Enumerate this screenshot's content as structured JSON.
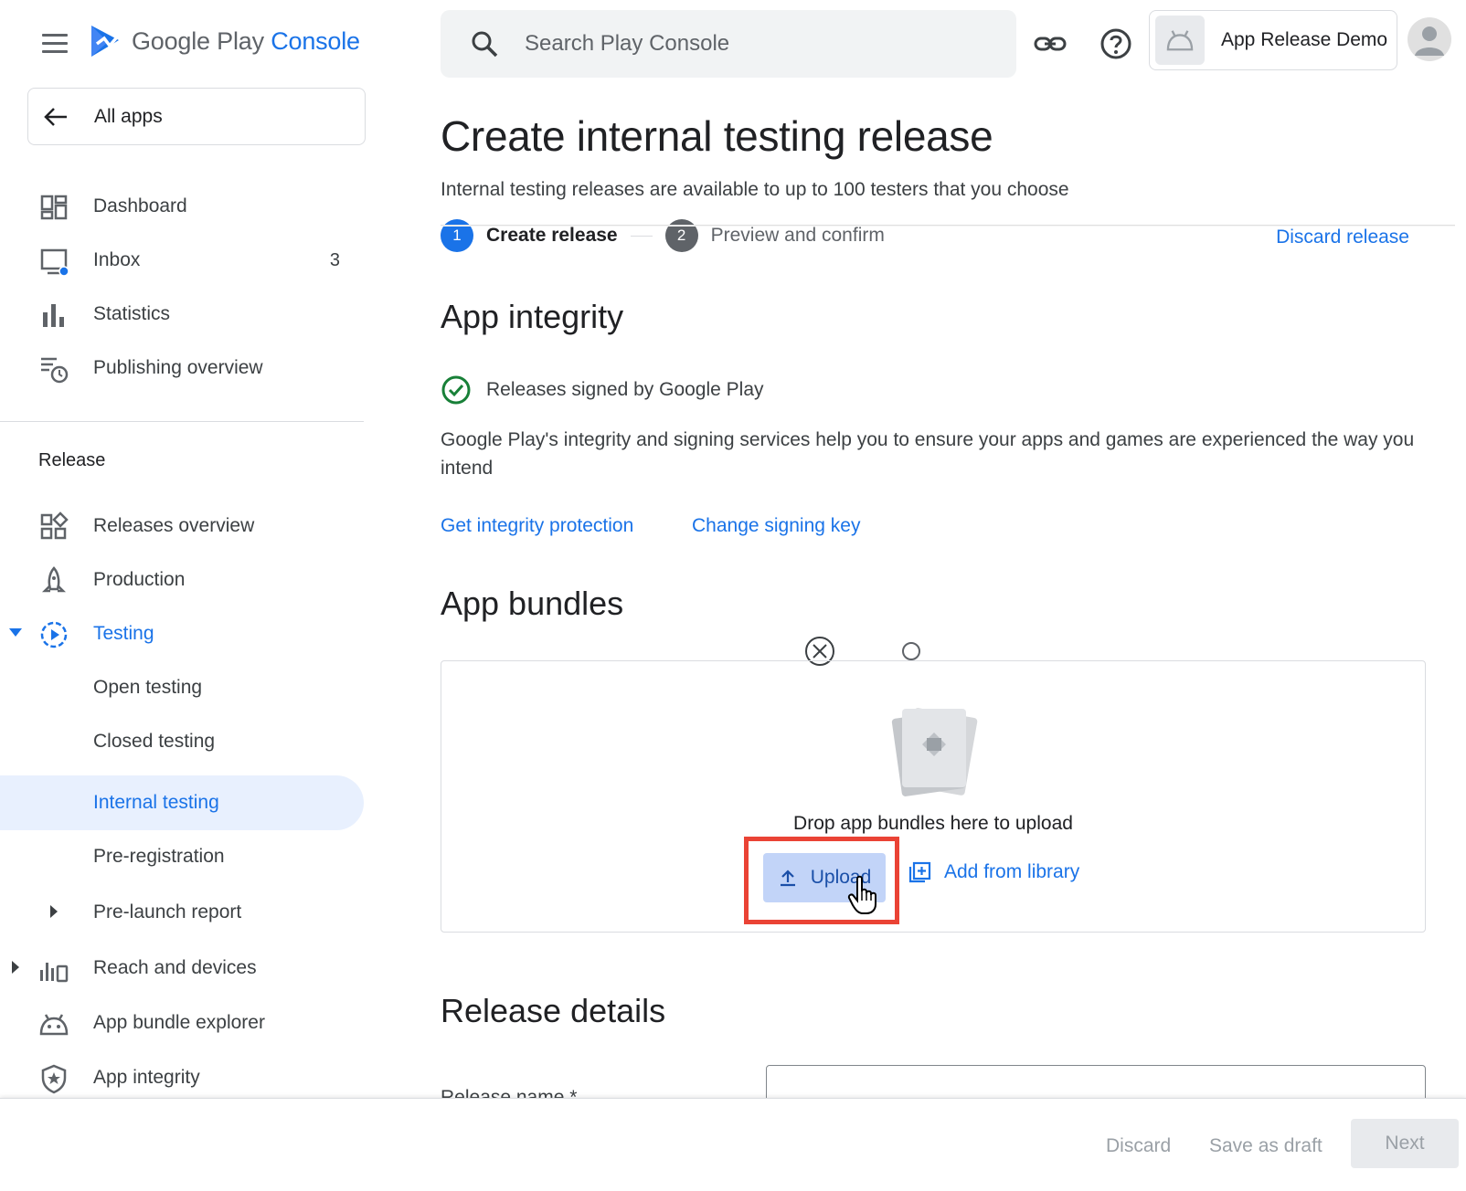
{
  "header": {
    "logo_text_main": "Google Play",
    "logo_text_accent": "Console",
    "search_placeholder": "Search Play Console",
    "app_name": "App Release Demo"
  },
  "sidebar": {
    "all_apps": "All apps",
    "top_items": [
      {
        "label": "Dashboard",
        "icon": "dashboard-icon"
      },
      {
        "label": "Inbox",
        "icon": "inbox-icon",
        "count": "3"
      },
      {
        "label": "Statistics",
        "icon": "bar-chart-icon"
      },
      {
        "label": "Publishing overview",
        "icon": "schedule-list-icon"
      }
    ],
    "section_label": "Release",
    "release_items": [
      {
        "label": "Releases overview",
        "icon": "releases-grid-icon"
      },
      {
        "label": "Production",
        "icon": "rocket-icon"
      },
      {
        "label": "Testing",
        "icon": "testing-play-icon",
        "expanded": true
      },
      {
        "label": "Open testing"
      },
      {
        "label": "Closed testing"
      },
      {
        "label": "Internal testing",
        "active": true
      },
      {
        "label": "Pre-registration"
      },
      {
        "label": "Pre-launch report",
        "icon": "chevron-right-icon"
      },
      {
        "label": "Reach and devices",
        "icon": "reach-devices-icon"
      },
      {
        "label": "App bundle explorer",
        "icon": "android-icon"
      },
      {
        "label": "App integrity",
        "icon": "shield-icon"
      }
    ]
  },
  "main": {
    "title": "Create internal testing release",
    "subtitle": "Internal testing releases are available to up to 100 testers that you choose",
    "steps": [
      {
        "num": "1",
        "label": "Create release",
        "current": true
      },
      {
        "num": "2",
        "label": "Preview and confirm",
        "current": false
      }
    ],
    "discard_release": "Discard release",
    "integrity": {
      "heading": "App integrity",
      "signed_text": "Releases signed by Google Play",
      "description": "Google Play's integrity and signing services help you to ensure your apps and games are experienced the way you intend",
      "link_protection": "Get integrity protection",
      "link_signing": "Change signing key"
    },
    "bundles": {
      "heading": "App bundles",
      "drop_text": "Drop app bundles here to upload",
      "upload_label": "Upload",
      "add_library_label": "Add from library"
    },
    "release_details": {
      "heading": "Release details",
      "name_label": "Release name  *",
      "name_value": ""
    }
  },
  "footer": {
    "discard": "Discard",
    "save_draft": "Save as draft",
    "next": "Next"
  },
  "colors": {
    "accent": "#1a73e8",
    "highlight": "#ea4335",
    "success": "#188038"
  }
}
